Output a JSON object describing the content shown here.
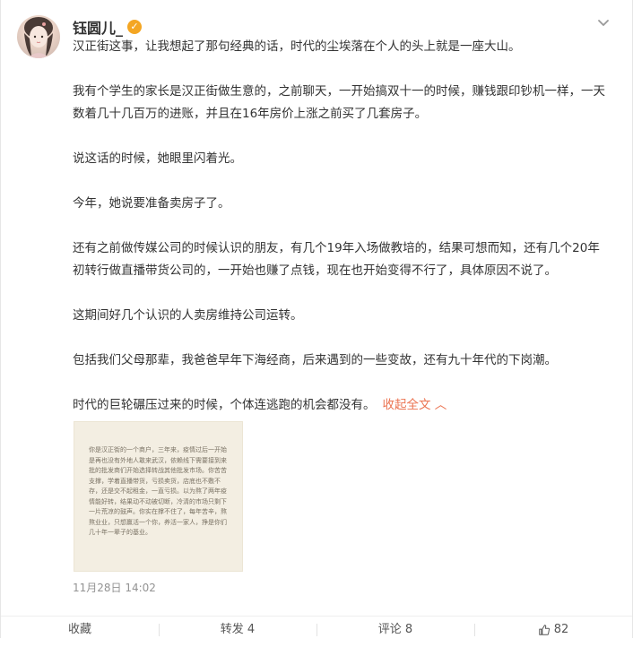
{
  "author": {
    "name": "钰圆儿_",
    "verified_icon": "verified-badge-icon",
    "verified_color": "#f4a623"
  },
  "post": {
    "paragraphs": [
      "汉正街这事，让我想起了那句经典的话，时代的尘埃落在个人的头上就是一座大山。",
      "我有个学生的家长是汉正街做生意的，之前聊天，一开始搞双十一的时候，赚钱跟印钞机一样，一天数着几十几百万的进账，并且在16年房价上涨之前买了几套房子。",
      "说这话的时候，她眼里闪着光。",
      "今年，她说要准备卖房子了。",
      "还有之前做传媒公司的时候认识的朋友，有几个19年入场做教培的，结果可想而知，还有几个20年初转行做直播带货公司的，一开始也赚了点钱，现在也开始变得不行了，具体原因不说了。",
      "这期间好几个认识的人卖房维持公司运转。",
      "包括我们父母那辈，我爸爸早年下海经商，后来遇到的一些变故，还有九十年代的下岗潮。"
    ],
    "last_paragraph": "时代的巨轮碾压过来的时候，个体连逃跑的机会都没有。",
    "collapse_label": "收起全文",
    "collapse_icon": "chevron-up-icon",
    "link_color": "#eb7350",
    "image_text": "你是汉正街的一个商户，三年来，疫情过后一开始是再也没有外地人敢来武汉，依赖线下需要接到来批的批发商们开始选择转战其他批发市场。你苦苦支撑，学着直播带货，亏损卖货，店底也不敷不存，还是交不起租金，一直亏损。以为熬了两年疫情能好转，结果动不动被切断，冷清的市场只剩下一片荒凉的鼓声。你实在撑不住了，每年苦辛，熬熬业业，只想赢活一个你，养活一家人，挣是你们几十年一辈子的基业。",
    "timestamp": "11月28日 14:02"
  },
  "footer": {
    "collect_label": "收藏",
    "repost_label": "转发 4",
    "comment_label": "评论 8",
    "like_count": "82",
    "like_icon": "thumbs-up-icon"
  },
  "colors": {
    "text": "#333333",
    "muted": "#939393"
  }
}
